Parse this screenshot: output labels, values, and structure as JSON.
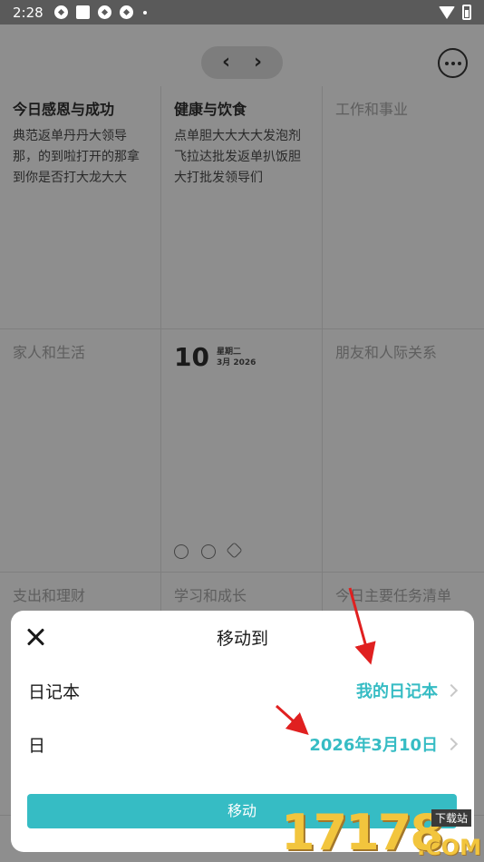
{
  "status_bar": {
    "time": "2:28"
  },
  "cells": [
    {
      "title": "今日感恩与成功",
      "body": "典范返单丹丹大领导那，的到啦打开的那拿到你是否打大龙大大"
    },
    {
      "title": "健康与饮食",
      "body": "点单胆大大大大发泡剂飞拉达批发返单扒饭胆大打批发领导们"
    },
    {
      "title": "工作和事业"
    },
    {
      "title": "家人和生活"
    },
    {
      "date_day": "10",
      "date_weekday": "星期二",
      "date_month": "3月 2026"
    },
    {
      "title": "朋友和人际关系"
    },
    {
      "title": "支出和理财"
    },
    {
      "title": "学习和成长"
    },
    {
      "title": "今日主要任务清单"
    }
  ],
  "sheet": {
    "title": "移动到",
    "rows": [
      {
        "label": "日记本",
        "value": "我的日记本"
      },
      {
        "label": "日",
        "value": "2026年3月10日"
      }
    ],
    "button_label": "移动"
  },
  "watermark": {
    "number": "17178",
    "tag": "下载站",
    "suffix": ".COM"
  },
  "colors": {
    "accent": "#36bcc4",
    "annotation": "#e02020"
  }
}
